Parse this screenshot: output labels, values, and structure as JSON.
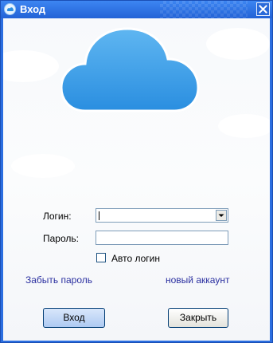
{
  "window": {
    "title": "Вход",
    "close_glyph": "✕",
    "title_icon": "app-logo-icon"
  },
  "form": {
    "login_label": "Логин:",
    "login_value": "",
    "password_label": "Пароль:",
    "password_value": "",
    "auto_login_label": "Авто логин",
    "auto_login_checked": false
  },
  "links": {
    "forgot_password": "Забыть пароль",
    "new_account": "новый аккаунт"
  },
  "buttons": {
    "login": "Вход",
    "close": "Закрыть"
  },
  "colors": {
    "titlebar": "#2a6ad9",
    "cloud": "#3da0e8",
    "link": "#2b30a0"
  }
}
